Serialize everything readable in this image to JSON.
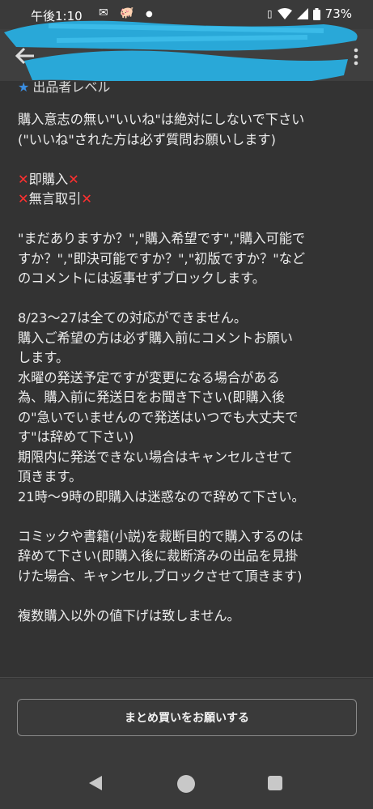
{
  "statusbar": {
    "time": "午後1:10",
    "battery": "73%"
  },
  "listing": {
    "partial_label": "出品者レベル",
    "lines": [
      "購入意志の無い\"いいね\"は絶対にしないで下さい",
      "(\"いいね\"された方は必ず質問お願いします)",
      "",
      "即購入",
      "無言取引",
      "",
      "\"まだありますか？\",\"購入希望です\",\"購入可能で",
      "すか？\",\"即決可能ですか？\",\"初版ですか？\"など",
      "のコメントには返事せずブロックします。",
      "",
      "8/23〜27は全ての対応ができません。",
      "購入ご希望の方は必ず購入前にコメントお願い",
      "します。",
      "水曜の発送予定ですが変更になる場合がある",
      "為、購入前に発送日をお聞き下さい(即購入後",
      "の\"急いでいませんので発送はいつでも大丈夫で",
      "す\"は辞めて下さい)",
      "期限内に発送できない場合はキャンセルさせて",
      "頂きます。",
      "21時〜9時の即購入は迷惑なので辞めて下さい。",
      "",
      "コミックや書籍(小説)を裁断目的で購入するのは",
      "辞めて下さい(即購入後に裁断済みの出品を見掛",
      "けた場合、キャンセル,ブロックさせて頂きます)",
      "",
      "複数購入以外の値下げは致しません。"
    ]
  },
  "actions": {
    "bundle_button": "まとめ買いをお願いする"
  },
  "colors": {
    "background": "#333333",
    "x_mark": "#ff3030",
    "scribble": "#29a8d8"
  },
  "icons": [
    "back-arrow-icon",
    "more-vert-icon",
    "wifi-icon",
    "signal-icon",
    "battery-icon",
    "nav-back-icon",
    "nav-home-icon",
    "nav-recent-icon"
  ]
}
